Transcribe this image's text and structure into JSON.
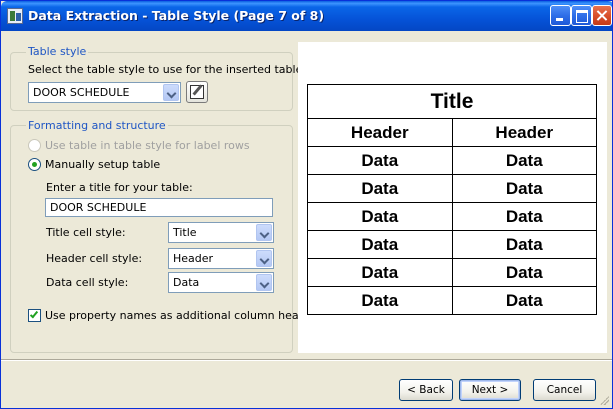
{
  "window": {
    "title": "Data Extraction - Table Style (Page 7 of 8)",
    "icon": "autocad-app-icon"
  },
  "table_style_group": {
    "label": "Table style",
    "instruction": "Select the table style to use for the inserted table:",
    "selected_style": "DOOR SCHEDULE",
    "edit_button_icon": "table-style-edit-icon"
  },
  "formatting_group": {
    "label": "Formatting and structure",
    "option_use_label_rows": "Use table in table style for label rows",
    "option_manual": "Manually setup table",
    "option_manual_selected": true,
    "title_prompt": "Enter a title for your table:",
    "title_value": "DOOR SCHEDULE",
    "title_cell_style_label": "Title cell style:",
    "title_cell_style_value": "Title",
    "header_cell_style_label": "Header cell style:",
    "header_cell_style_value": "Header",
    "data_cell_style_label": "Data cell style:",
    "data_cell_style_value": "Data",
    "use_property_names_label": "Use property names as additional column headers",
    "use_property_names_checked": true
  },
  "preview": {
    "title": "Title",
    "headers": [
      "Header",
      "Header"
    ],
    "rows": [
      [
        "Data",
        "Data"
      ],
      [
        "Data",
        "Data"
      ],
      [
        "Data",
        "Data"
      ],
      [
        "Data",
        "Data"
      ],
      [
        "Data",
        "Data"
      ],
      [
        "Data",
        "Data"
      ]
    ]
  },
  "buttons": {
    "back": "< Back",
    "next": "Next >",
    "cancel": "Cancel"
  },
  "colors": {
    "titlebar": "#0553d8",
    "group_label": "#1f56c4",
    "dialog_bg": "#ece9d8"
  }
}
